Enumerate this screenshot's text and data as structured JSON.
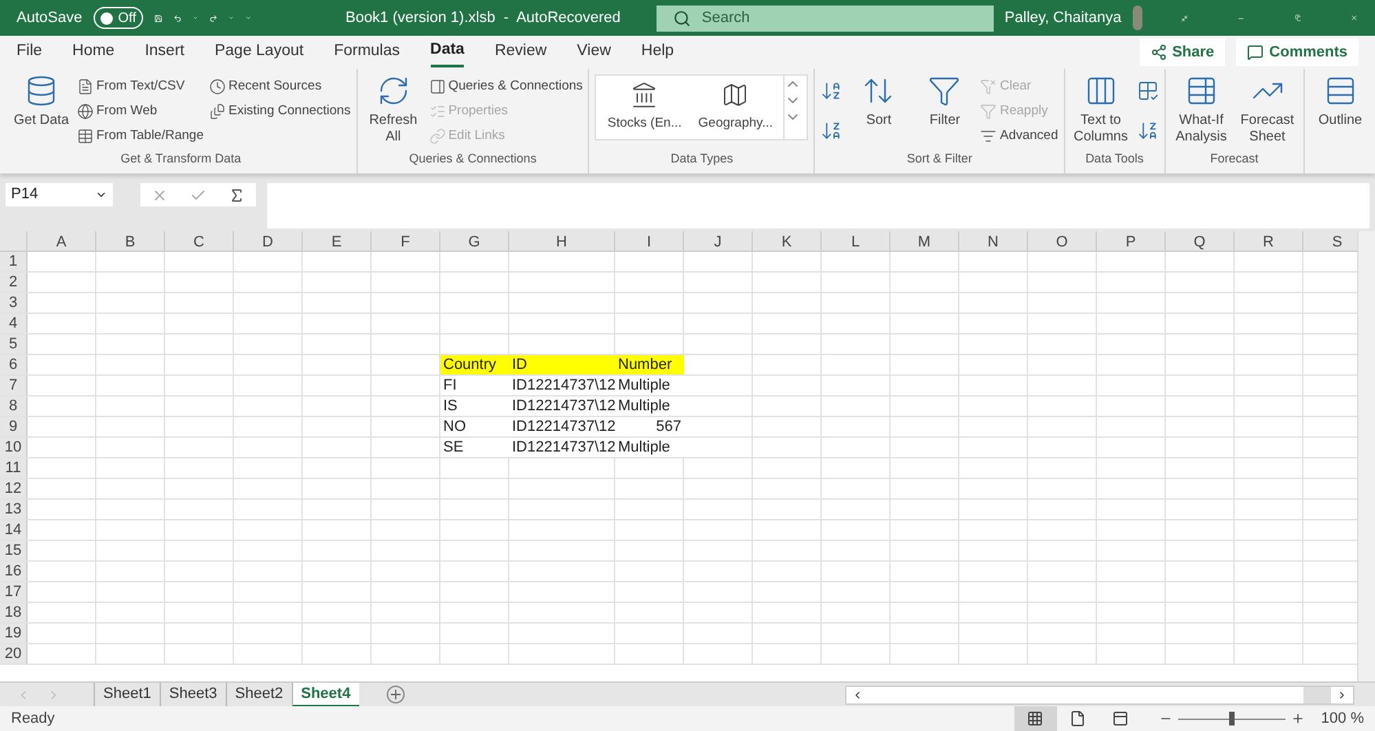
{
  "title_bar": {
    "autosave_label": "AutoSave",
    "autosave_toggle": {
      "label": "Off",
      "on": false
    },
    "document_title": "Book1 (version 1).xlsb  -  AutoRecovered",
    "search": {
      "placeholder": "Search"
    },
    "user": "Palley, Chaitanya"
  },
  "ribbon_tabs": [
    {
      "label": "File",
      "selected": false
    },
    {
      "label": "Home",
      "selected": false
    },
    {
      "label": "Insert",
      "selected": false
    },
    {
      "label": "Page Layout",
      "selected": false
    },
    {
      "label": "Formulas",
      "selected": false
    },
    {
      "label": "Data",
      "selected": true
    },
    {
      "label": "Review",
      "selected": false
    },
    {
      "label": "View",
      "selected": false
    },
    {
      "label": "Help",
      "selected": false
    }
  ],
  "share_button": "Share",
  "comments_button": "Comments",
  "ribbon_groups": [
    {
      "label": "Get & Transform Data",
      "items": [
        {
          "kind": "large",
          "label": "Get Data",
          "disabled": false
        },
        {
          "kind": "small",
          "label": "From Text/CSV",
          "disabled": false
        },
        {
          "kind": "small",
          "label": "From Web",
          "disabled": false
        },
        {
          "kind": "small",
          "label": "From Table/Range",
          "disabled": false
        },
        {
          "kind": "small",
          "label": "Recent Sources",
          "disabled": false
        },
        {
          "kind": "small",
          "label": "Existing Connections",
          "disabled": false
        }
      ]
    },
    {
      "label": "Queries & Connections",
      "items": [
        {
          "kind": "large",
          "label": "Refresh All",
          "disabled": false
        },
        {
          "kind": "small",
          "label": "Queries & Connections",
          "disabled": false
        },
        {
          "kind": "small",
          "label": "Properties",
          "disabled": true
        },
        {
          "kind": "small",
          "label": "Edit Links",
          "disabled": true
        }
      ]
    },
    {
      "label": "Data Types",
      "items": [
        {
          "kind": "gallery",
          "label": "Stocks (En...",
          "disabled": false
        },
        {
          "kind": "gallery",
          "label": "Geography...",
          "disabled": false
        }
      ]
    },
    {
      "label": "Sort & Filter",
      "items": [
        {
          "kind": "icon",
          "disabled": false
        },
        {
          "kind": "large",
          "label": "Sort",
          "disabled": false
        },
        {
          "kind": "large",
          "label": "Filter",
          "disabled": false
        },
        {
          "kind": "small",
          "label": "Clear",
          "disabled": true
        },
        {
          "kind": "small",
          "label": "Reapply",
          "disabled": true
        },
        {
          "kind": "small",
          "label": "Advanced",
          "disabled": false
        }
      ]
    },
    {
      "label": "Data Tools",
      "items": [
        {
          "kind": "large",
          "label": "Text to Columns",
          "disabled": false
        },
        {
          "kind": "icon",
          "disabled": false
        }
      ]
    },
    {
      "label": "Forecast",
      "items": [
        {
          "kind": "large",
          "label": "What-If Analysis",
          "disabled": false
        },
        {
          "kind": "large",
          "label": "Forecast Sheet",
          "disabled": false
        }
      ]
    },
    {
      "items": [
        {
          "kind": "large",
          "label": "Outline",
          "disabled": false
        }
      ]
    }
  ],
  "name_box": "P14",
  "columns": [
    "A",
    "B",
    "C",
    "D",
    "E",
    "F",
    "G",
    "H",
    "I",
    "J",
    "K",
    "L",
    "M",
    "N",
    "O",
    "P",
    "Q",
    "R",
    "S"
  ],
  "row_headers": [
    "1",
    "2",
    "3",
    "4",
    "5",
    "6",
    "7",
    "8",
    "9",
    "10",
    "11",
    "12",
    "13",
    "14",
    "15",
    "16",
    "17",
    "18",
    "19",
    "20"
  ],
  "table": {
    "header": [
      "Country",
      "ID",
      "Number"
    ],
    "rows": [
      [
        {
          "text": "FI",
          "kind": "text"
        },
        {
          "text": "ID12214737\\12",
          "kind": "text"
        },
        {
          "text": "Multiple",
          "kind": "text"
        }
      ],
      [
        {
          "text": "IS",
          "kind": "text"
        },
        {
          "text": "ID12214737\\12",
          "kind": "text"
        },
        {
          "text": "Multiple",
          "kind": "text"
        }
      ],
      [
        {
          "text": "NO",
          "kind": "text"
        },
        {
          "text": "ID12214737\\12",
          "kind": "text"
        },
        {
          "text": "567",
          "kind": "number"
        }
      ],
      [
        {
          "text": "SE",
          "kind": "text"
        },
        {
          "text": "ID12214737\\12",
          "kind": "text"
        },
        {
          "text": "Multiple",
          "kind": "text"
        }
      ]
    ]
  },
  "sheet_tabs": [
    {
      "label": "Sheet1",
      "selected": false
    },
    {
      "label": "Sheet3",
      "selected": false
    },
    {
      "label": "Sheet2",
      "selected": false
    },
    {
      "label": "Sheet4",
      "selected": true
    }
  ],
  "status_bar": {
    "status": "Ready",
    "views": [
      {
        "selected": true
      },
      {
        "selected": false
      },
      {
        "selected": false
      }
    ],
    "zoom": {
      "level": 0.5,
      "reading": "100 %"
    }
  }
}
